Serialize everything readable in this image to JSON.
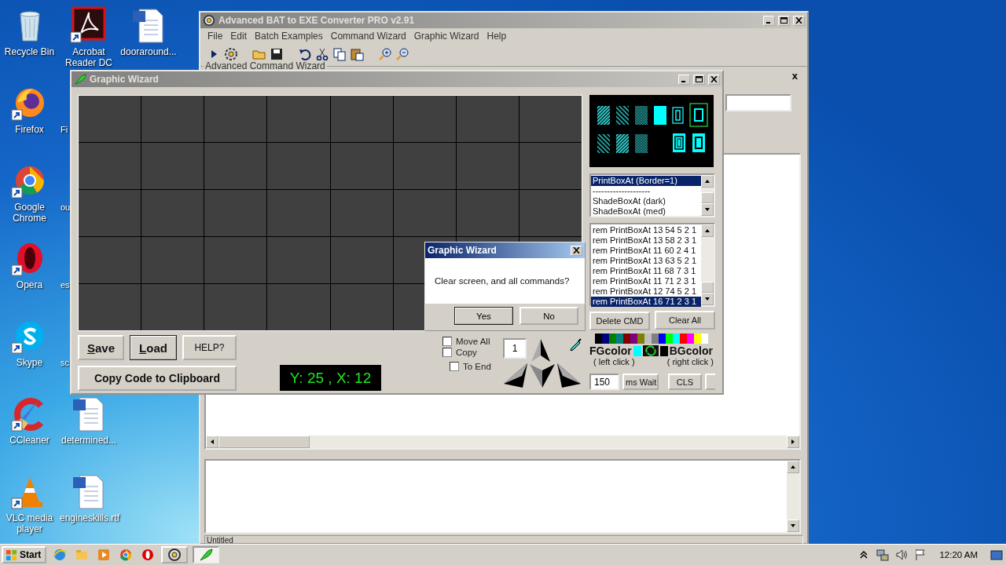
{
  "desktop": {
    "icons": [
      {
        "label": "Recycle Bin",
        "kind": "recycle",
        "shortcut": false
      },
      {
        "label": "Firefox",
        "kind": "firefox",
        "shortcut": true
      },
      {
        "label": "Google Chrome",
        "kind": "chrome",
        "shortcut": true
      },
      {
        "label": "Opera",
        "kind": "opera",
        "shortcut": true
      },
      {
        "label": "Skype",
        "kind": "skype",
        "shortcut": true
      },
      {
        "label": "CCleaner",
        "kind": "ccleaner",
        "shortcut": true
      },
      {
        "label": "VLC media player",
        "kind": "vlc",
        "shortcut": true
      },
      {
        "label": "Acrobat Reader DC",
        "kind": "pdf",
        "shortcut": true
      },
      {
        "label": "Fi",
        "kind": "covered"
      },
      {
        "label": "ou",
        "kind": "covered"
      },
      {
        "label": "es",
        "kind": "covered"
      },
      {
        "label": "sc",
        "kind": "covered"
      },
      {
        "label": "determined...",
        "kind": "doc",
        "shortcut": false
      },
      {
        "label": "engineskills.rtf",
        "kind": "doc",
        "shortcut": false
      },
      {
        "label": "dooraround...",
        "kind": "doc",
        "shortcut": false
      }
    ]
  },
  "main_window": {
    "title": "Advanced BAT to EXE Converter PRO v2.91",
    "menu": [
      "File",
      "Edit",
      "Batch Examples",
      "Command Wizard",
      "Graphic Wizard",
      "Help"
    ],
    "group_label": "Advanced Command Wizard",
    "panel_close": "x",
    "status_bar": "Untitled"
  },
  "graphic_wizard": {
    "title": "Graphic Wizard",
    "buttons": [
      {
        "label": "Save",
        "mnemonic": true,
        "default": false
      },
      {
        "label": "Load",
        "mnemonic": true,
        "default": true
      },
      {
        "label": "HELP?",
        "mnemonic": false,
        "default": false
      }
    ],
    "copy_button": "Copy Code to Clipboard",
    "coordinates": "Y: 25 , X: 12",
    "checkboxes": [
      {
        "label": "Move All",
        "checked": false
      },
      {
        "label": "Copy",
        "checked": false
      },
      {
        "label": "To End",
        "checked": false
      }
    ],
    "step": "1",
    "box_types": [
      {
        "label": "PrintBoxAt (Border=1)",
        "selected": true
      },
      {
        "label": "--------------------",
        "selected": false
      },
      {
        "label": "ShadeBoxAt (dark)",
        "selected": false
      },
      {
        "label": "ShadeBoxAt (med)",
        "selected": false
      }
    ],
    "commands": [
      {
        "label": "rem PrintBoxAt 13 54 5 2 1",
        "selected": false
      },
      {
        "label": "rem PrintBoxAt 13 58 2 3 1",
        "selected": false
      },
      {
        "label": "rem PrintBoxAt 11 60 2 4 1",
        "selected": false
      },
      {
        "label": "rem PrintBoxAt 13 63 5 2 1",
        "selected": false
      },
      {
        "label": "rem PrintBoxAt 11 68 7 3 1",
        "selected": false
      },
      {
        "label": "rem PrintBoxAt 11 71 2 3 1",
        "selected": false
      },
      {
        "label": "rem PrintBoxAt 12 74 5 2 1",
        "selected": false
      },
      {
        "label": "rem PrintBoxAt 16 71 2 3 1",
        "selected": true
      }
    ],
    "delete_button": "Delete CMD",
    "clear_button": "Clear All",
    "palette": [
      {
        "color": "#000000"
      },
      {
        "color": "#000080"
      },
      {
        "color": "#008000"
      },
      {
        "color": "#008080"
      },
      {
        "color": "#800000"
      },
      {
        "color": "#800080"
      },
      {
        "color": "#808000"
      },
      {
        "color": "#c0c0c0"
      },
      {
        "color": "#808080"
      },
      {
        "color": "#0000ff"
      },
      {
        "color": "#00ff00"
      },
      {
        "color": "#00ffff"
      },
      {
        "color": "#ff0000"
      },
      {
        "color": "#ff00ff"
      },
      {
        "color": "#ffff00"
      },
      {
        "color": "#ffffff"
      }
    ],
    "fg_label": "FGcolor",
    "fg_hint": "( left click )",
    "fg_swatch": {
      "color": "#00ffff"
    },
    "bg_label": "BGcolor",
    "bg_hint": "( right click )",
    "bg_swatch": {
      "color": "#000000"
    },
    "wait": "150",
    "wait_button": "ms Wait",
    "cls_button": "CLS"
  },
  "dialog": {
    "title": "Graphic Wizard",
    "message": "Clear screen, and all commands?",
    "buttons": [
      {
        "label": "Yes",
        "default": true
      },
      {
        "label": "No",
        "default": false
      }
    ]
  },
  "taskbar": {
    "start": "Start",
    "quick_launch": [
      {
        "kind": "ie"
      },
      {
        "kind": "explorer"
      },
      {
        "kind": "media"
      },
      {
        "kind": "chrome"
      },
      {
        "kind": "opera"
      }
    ],
    "tasks": [
      {
        "kind": "converter",
        "selected": false
      },
      {
        "kind": "wizard",
        "selected": true
      }
    ],
    "clock": "12:20 AM"
  }
}
